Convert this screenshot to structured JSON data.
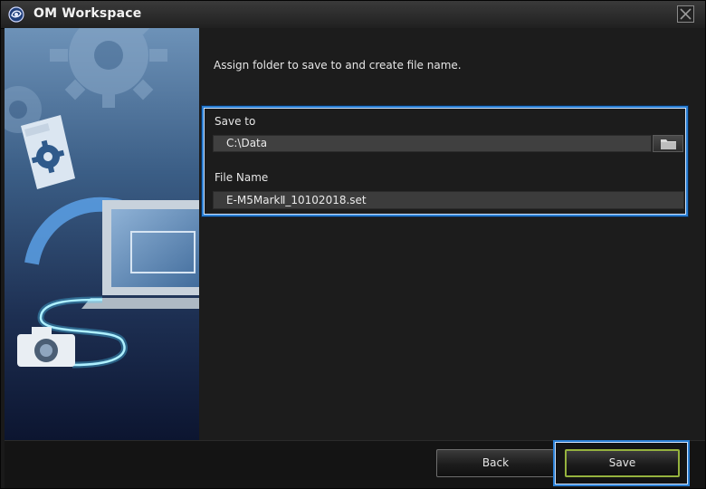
{
  "window": {
    "title": "OM Workspace",
    "icons": {
      "app": "om-workspace-logo-icon",
      "close": "close-icon"
    }
  },
  "dialog": {
    "instruction": "Assign folder to save to and create file name.",
    "save_to": {
      "label": "Save to",
      "value": "C:\\Data",
      "browse_icon": "folder-icon"
    },
    "file_name": {
      "label": "File Name",
      "value": "E-M5MarkⅡ_10102018.set"
    }
  },
  "footer": {
    "back_label": "Back",
    "save_label": "Save"
  },
  "colors": {
    "highlight": "#2a7fd4",
    "save_border": "#95b23e",
    "background": "#1c1c1c"
  }
}
